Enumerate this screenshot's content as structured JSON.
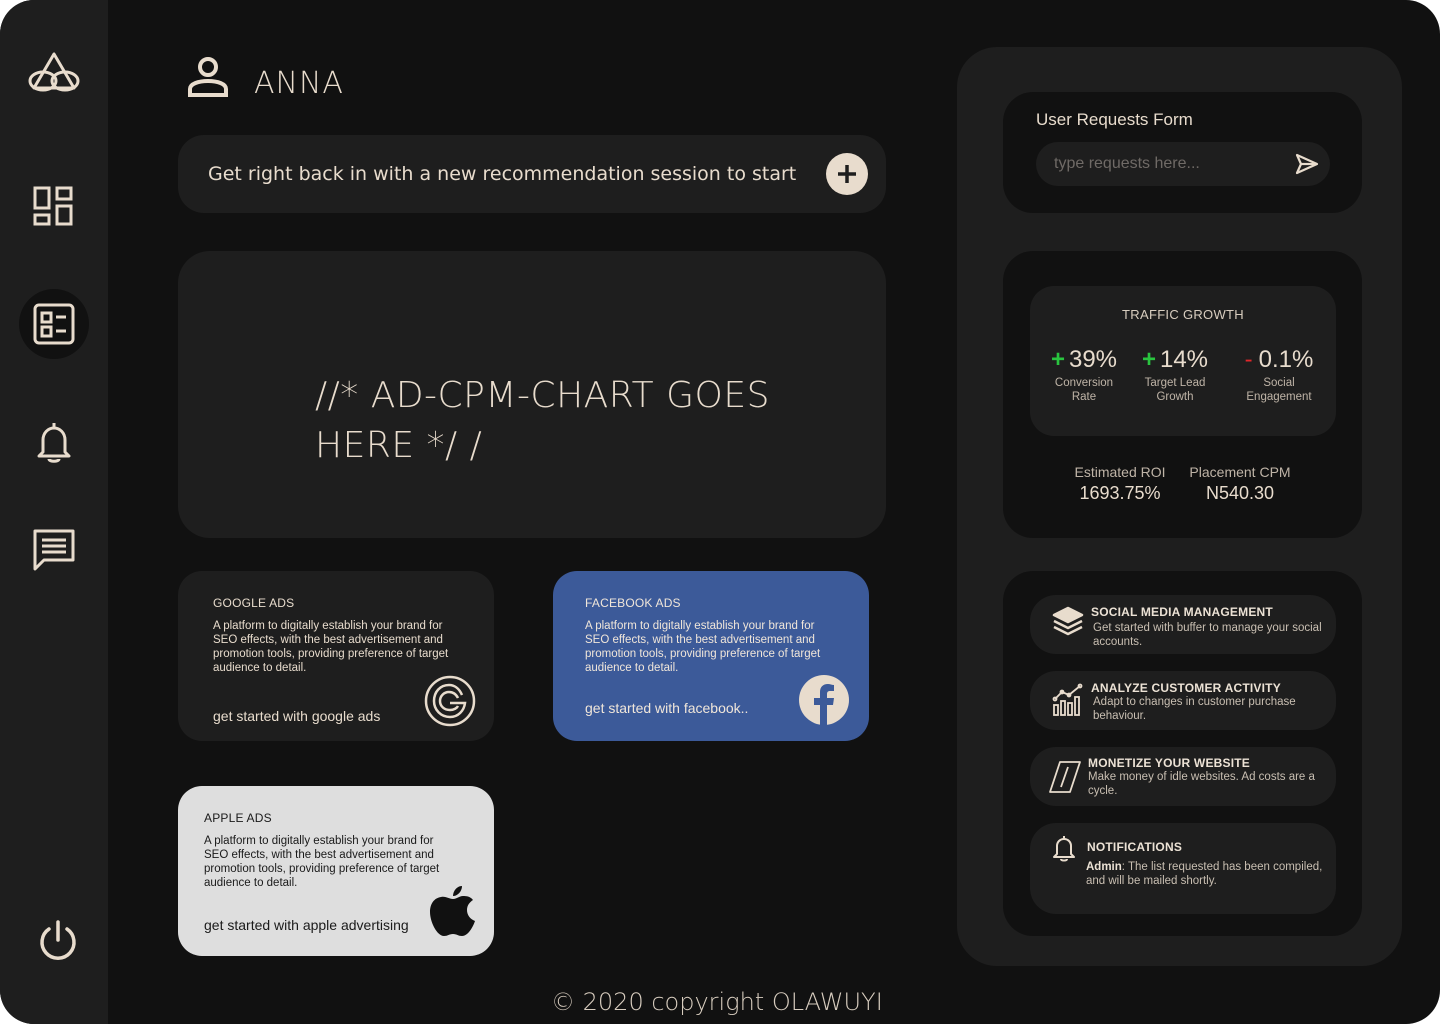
{
  "user": {
    "name": "ANNA"
  },
  "session": {
    "text": "Get right back in with a new recommendation session to start"
  },
  "chart_placeholder": {
    "line1": "//* AD-CPM-CHART GOES",
    "line2": "HERE */ /"
  },
  "ads": {
    "google": {
      "title": "GOOGLE ADS",
      "description": "A platform to digitally establish your brand for SEO effects, with the best  advertisement  and promotion tools, providing preference of target audience to detail.",
      "link": "get started with google ads"
    },
    "facebook": {
      "title": "FACEBOOK ADS",
      "description": "A platform to digitally establish your brand for SEO effects, with the best  advertisement  and promotion tools, providing preference of target audience to detail.",
      "link": "get started with facebook.."
    },
    "apple": {
      "title": "APPLE ADS",
      "description": "A platform to digitally establish your brand for SEO effects, with the best  advertisement  and promotion tools, providing preference of target audience to detail.",
      "link": "get started with apple advertising"
    }
  },
  "footer": {
    "text": "© 2020 copyright OLAWUYI"
  },
  "requests": {
    "title": "User Requests Form",
    "placeholder": "type requests here..."
  },
  "traffic": {
    "title": "TRAFFIC GROWTH",
    "metrics": [
      {
        "sign": "+",
        "value": "39%",
        "label": "Conversion Rate"
      },
      {
        "sign": "+",
        "value": "14%",
        "label": "Target Lead Growth"
      },
      {
        "sign": "-",
        "value": "0.1%",
        "label": "Social Engagement"
      }
    ]
  },
  "kpis": [
    {
      "label": "Estimated ROI",
      "value": "1693.75%"
    },
    {
      "label": "Placement CPM",
      "value": "N540.30"
    }
  ],
  "services": [
    {
      "title": "SOCIAL MEDIA MANAGEMENT",
      "description": "Get started with buffer to manage your social accounts.",
      "icon": "layers-icon"
    },
    {
      "title": "ANALYZE CUSTOMER ACTIVITY",
      "description": "Adapt to changes in customer purchase behaviour.",
      "icon": "analytics-icon"
    },
    {
      "title": "MONETIZE YOUR WEBSITE",
      "description": "Make money of idle websites. Ad costs are a cycle.",
      "icon": "monetize-icon"
    },
    {
      "title": "NOTIFICATIONS",
      "author": "Admin",
      "description": ": The list requested has been compiled, and will be mailed shortly.",
      "icon": "bell-icon"
    }
  ],
  "colors": {
    "accent": "#e8dccd",
    "background": "#111111",
    "panel": "#1e1e1e",
    "facebook": "#3c5a99",
    "apple_card": "#dedede",
    "positive": "#29c43f",
    "negative": "#e0272b"
  }
}
